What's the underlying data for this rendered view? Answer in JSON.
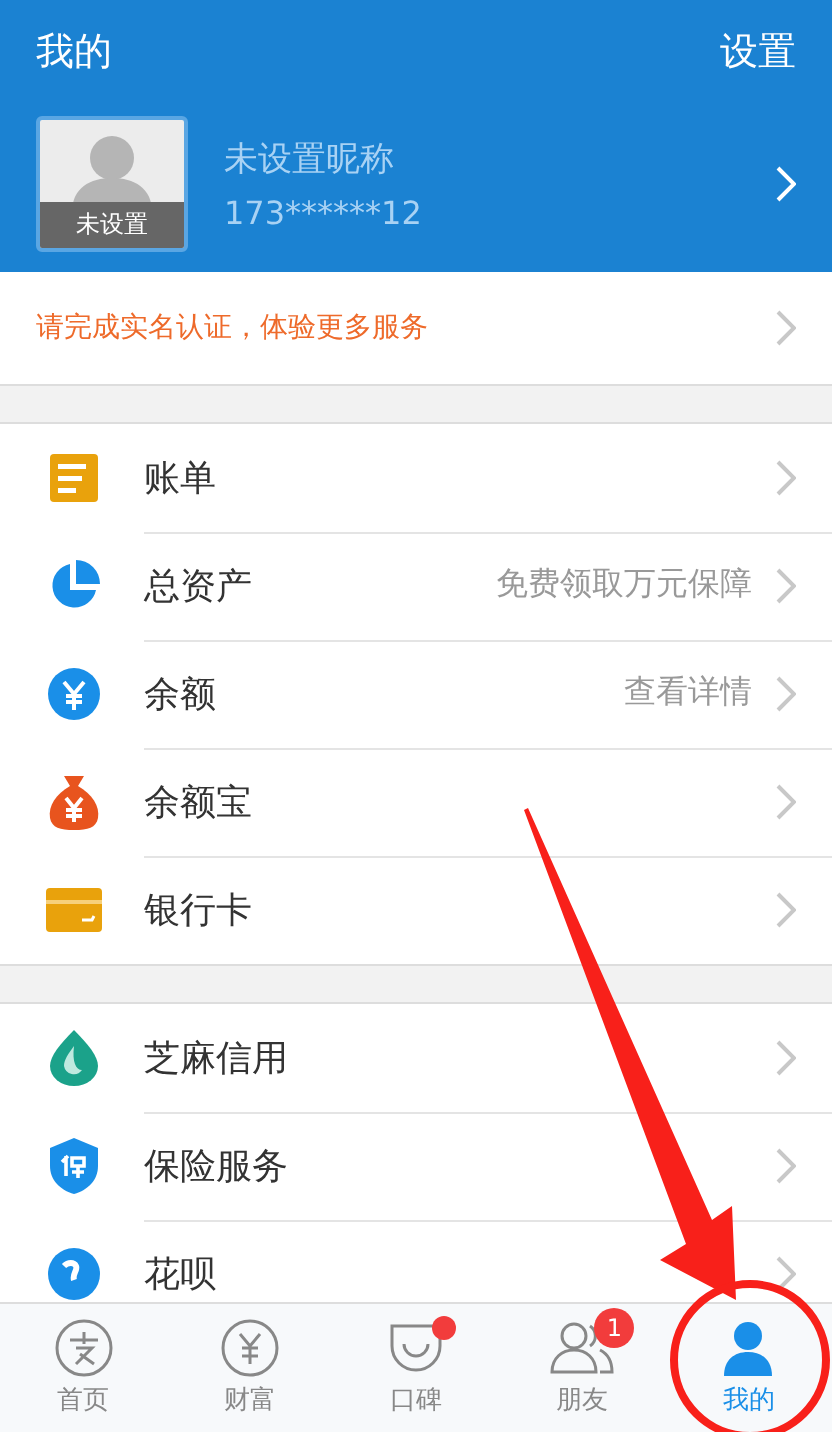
{
  "header": {
    "title": "我的",
    "settings": "设置"
  },
  "profile": {
    "avatar_label": "未设置",
    "nickname": "未设置昵称",
    "phone": "173******12"
  },
  "notice": "请完成实名认证，体验更多服务",
  "groups": [
    [
      {
        "label": "账单"
      },
      {
        "label": "总资产",
        "detail": "免费领取万元保障"
      },
      {
        "label": "余额",
        "detail": "查看详情"
      },
      {
        "label": "余额宝"
      },
      {
        "label": "银行卡"
      }
    ],
    [
      {
        "label": "芝麻信用"
      },
      {
        "label": "保险服务"
      },
      {
        "label": "花呗"
      }
    ]
  ],
  "tabbar": [
    {
      "label": "首页",
      "selected": false,
      "dot": false
    },
    {
      "label": "财富",
      "selected": false,
      "dot": false
    },
    {
      "label": "口碑",
      "selected": false,
      "dot": true
    },
    {
      "label": "朋友",
      "selected": false,
      "dot": false,
      "badge": "1"
    },
    {
      "label": "我的",
      "selected": true,
      "dot": false
    }
  ]
}
